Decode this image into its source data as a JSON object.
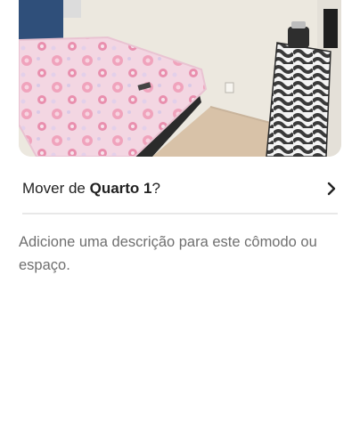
{
  "photo": {
    "alt": "Quarto 1 photo",
    "icon": "room-photo"
  },
  "move": {
    "prefix": "Mover de ",
    "room": "Quarto 1",
    "suffix": "?",
    "chevron_icon": "chevron-right-icon"
  },
  "description_placeholder": "Adicione uma descrição para este cômodo ou espaço.",
  "colors": {
    "text": "#222222",
    "muted": "#6f6f6f",
    "divider": "#e8e8e8"
  }
}
